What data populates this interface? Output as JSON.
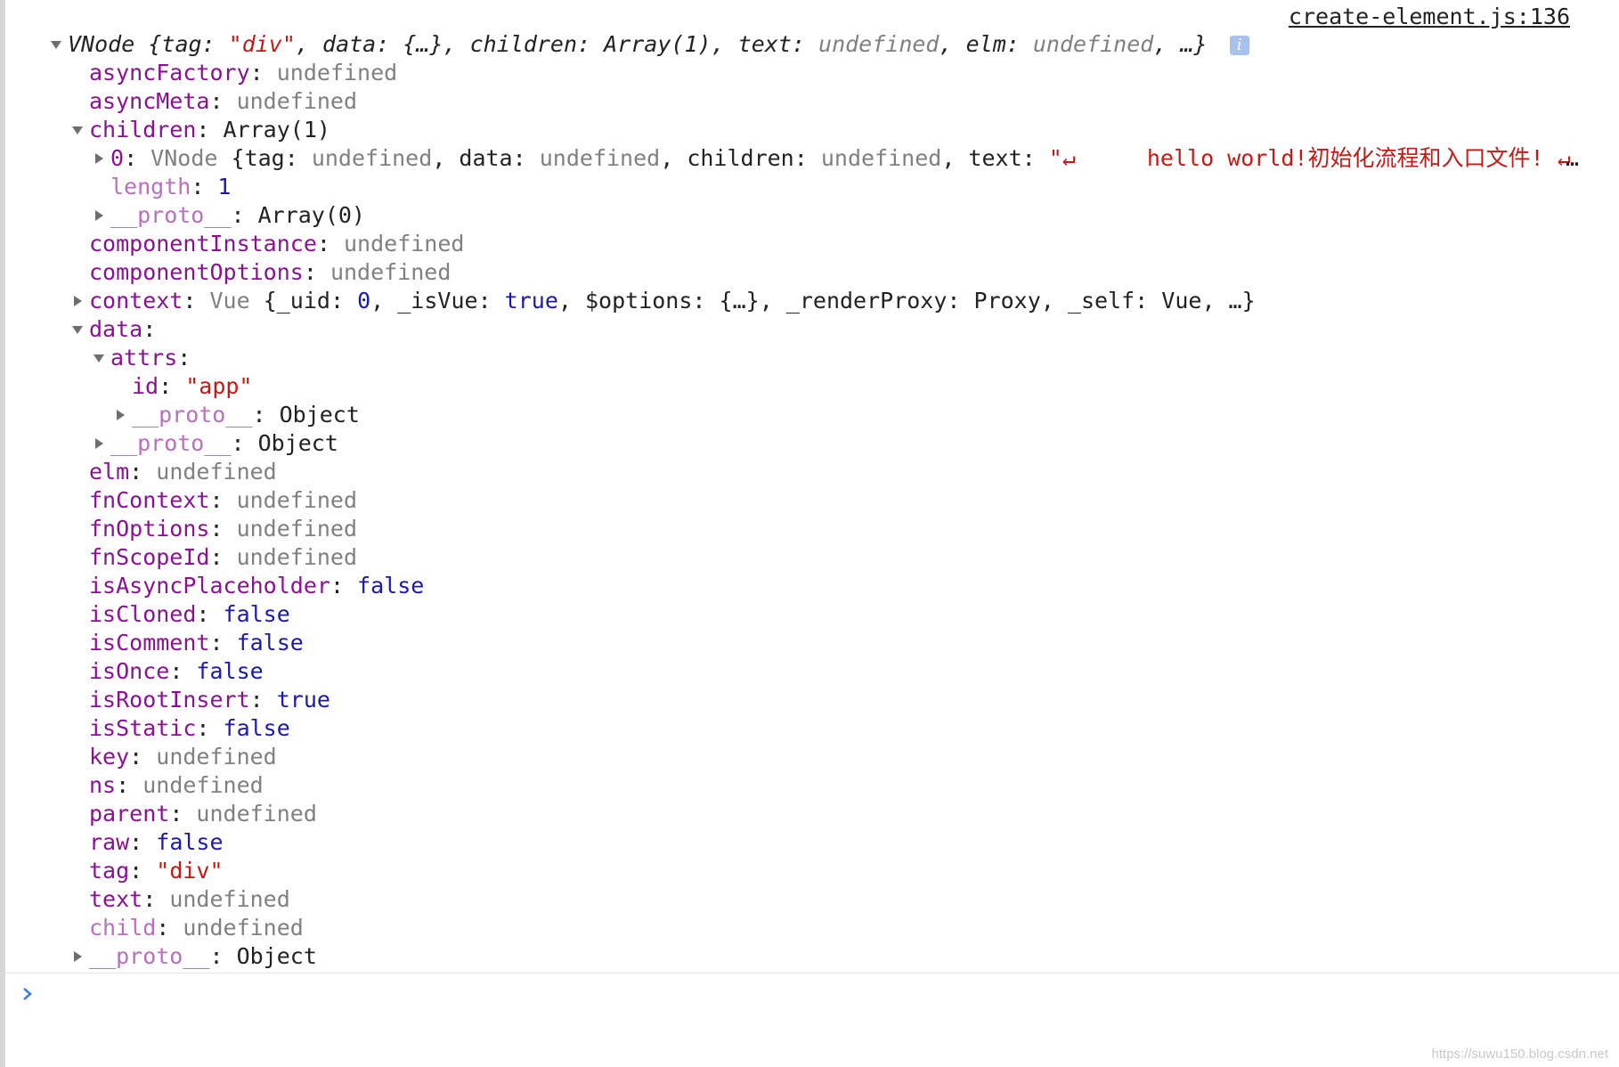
{
  "source": {
    "link": "create-element.js:136"
  },
  "summary": {
    "vnode": "VNode",
    "open": "{",
    "tag_key": "tag",
    "tag_val": "\"div\"",
    "data_key": "data",
    "data_val": "{…}",
    "children_key": "children",
    "children_val": "Array(1)",
    "text_key": "text",
    "text_val": "undefined",
    "elm_key": "elm",
    "elm_val": "undefined",
    "ellipsis_close": "…}",
    "info": "i"
  },
  "rows": {
    "asyncFactory": {
      "key": "asyncFactory",
      "val": "undefined"
    },
    "asyncMeta": {
      "key": "asyncMeta",
      "val": "undefined"
    },
    "children": {
      "key": "children",
      "val": "Array(1)"
    },
    "child0": {
      "index": "0",
      "vnode": "VNode",
      "open": "{",
      "tag_key": "tag",
      "tag_val": "undefined",
      "data_key": "data",
      "data_val": "undefined",
      "children_key": "children",
      "children_val": "undefined",
      "text_key": "text",
      "text_quote": "\"↵",
      "text_content": "hello world!初始化流程和入口文件! ↵",
      "ellipsis": "…"
    },
    "length": {
      "key": "length",
      "val": "1"
    },
    "children_proto": {
      "key": "__proto__",
      "val": "Array(0)"
    },
    "componentInstance": {
      "key": "componentInstance",
      "val": "undefined"
    },
    "componentOptions": {
      "key": "componentOptions",
      "val": "undefined"
    },
    "context": {
      "key": "context",
      "type": "Vue",
      "open": "{",
      "uid_key": "_uid",
      "uid_val": "0",
      "isvue_key": "_isVue",
      "isvue_val": "true",
      "options_key": "$options",
      "options_val": "{…}",
      "render_key": "_renderProxy",
      "render_val": "Proxy",
      "self_key": "_self",
      "self_val": "Vue",
      "close": "…}"
    },
    "data": {
      "key": "data"
    },
    "attrs": {
      "key": "attrs"
    },
    "id": {
      "key": "id",
      "val": "\"app\""
    },
    "attrs_proto": {
      "key": "__proto__",
      "val": "Object"
    },
    "data_proto": {
      "key": "__proto__",
      "val": "Object"
    },
    "elm": {
      "key": "elm",
      "val": "undefined"
    },
    "fnContext": {
      "key": "fnContext",
      "val": "undefined"
    },
    "fnOptions": {
      "key": "fnOptions",
      "val": "undefined"
    },
    "fnScopeId": {
      "key": "fnScopeId",
      "val": "undefined"
    },
    "isAsyncPlaceholder": {
      "key": "isAsyncPlaceholder",
      "val": "false"
    },
    "isCloned": {
      "key": "isCloned",
      "val": "false"
    },
    "isComment": {
      "key": "isComment",
      "val": "false"
    },
    "isOnce": {
      "key": "isOnce",
      "val": "false"
    },
    "isRootInsert": {
      "key": "isRootInsert",
      "val": "true"
    },
    "isStatic": {
      "key": "isStatic",
      "val": "false"
    },
    "key": {
      "key": "key",
      "val": "undefined"
    },
    "ns": {
      "key": "ns",
      "val": "undefined"
    },
    "parent": {
      "key": "parent",
      "val": "undefined"
    },
    "raw": {
      "key": "raw",
      "val": "false"
    },
    "tag": {
      "key": "tag",
      "val": "\"div\""
    },
    "text": {
      "key": "text",
      "val": "undefined"
    },
    "child": {
      "key": "child",
      "val": "undefined"
    },
    "root_proto": {
      "key": "__proto__",
      "val": "Object"
    }
  },
  "watermark": "https://suwu150.blog.csdn.net",
  "colors": {
    "key": "#881391",
    "faded_key": "#b871bc",
    "undefined": "#808080",
    "string": "#c41a16",
    "number_boolean": "#1a1aa6",
    "prompt": "#3b7be8",
    "info_badge": "#a8c1ef"
  }
}
